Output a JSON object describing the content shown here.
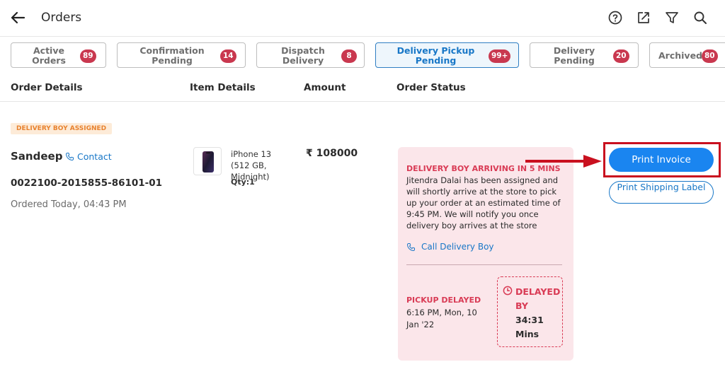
{
  "header": {
    "title": "Orders",
    "icons": [
      "back-arrow-icon",
      "help-icon",
      "share-icon",
      "filter-icon",
      "search-icon"
    ]
  },
  "tabs": [
    {
      "label": "Active Orders",
      "count": "89",
      "active": false
    },
    {
      "label": "Confirmation Pending",
      "count": "14",
      "active": false
    },
    {
      "label": "Dispatch Delivery",
      "count": "8",
      "active": false
    },
    {
      "label": "Delivery Pickup Pending",
      "count": "99+",
      "active": true
    },
    {
      "label": "Delivery Pending",
      "count": "20",
      "active": false
    },
    {
      "label": "Archived",
      "count": "80",
      "active": false
    }
  ],
  "columns": [
    "Order Details",
    "Item Details",
    "Amount",
    "Order Status"
  ],
  "order": {
    "tag": "DELIVERY BOY ASSIGNED",
    "customer": "Sandeep",
    "contact_label": "Contact",
    "order_id": "0022100-2015855-86101-01",
    "ordered_at": "Ordered Today, 04:43 PM",
    "item_name": "iPhone 13 (512 GB, Midnight)",
    "qty": "Qty:1",
    "amount": "₹ 108000",
    "status": {
      "title": "DELIVERY BOY ARRIVING IN 5 MINS",
      "description": "Jitendra Dalai has been assigned and will shortly arrive at the store to pick up your order at an estimated time of 9:45 PM. We will notify you once delivery boy arrives at the store",
      "call_label": "Call Delivery Boy",
      "pickup_title": "PICKUP DELAYED",
      "pickup_time": "6:16 PM, Mon, 10 Jan '22",
      "delay_label": "DELAYED BY",
      "delay_value": "34:31 Mins"
    },
    "actions": {
      "print_invoice": "Print Invoice",
      "print_label": "Print Shipping Label"
    }
  },
  "colors": {
    "accent": "#1a85f0",
    "badge": "#c9384f",
    "alert": "#d93b55",
    "highlight": "#c9101f",
    "status_bg": "#fbe6ea"
  }
}
